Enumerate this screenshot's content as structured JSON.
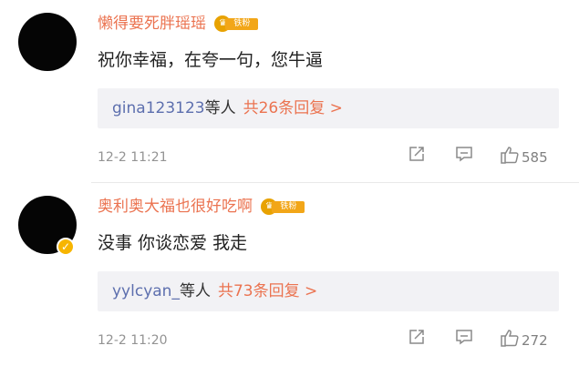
{
  "comments": [
    {
      "username": "懒得要死胖瑶瑶",
      "badge": {
        "label": "铁粉"
      },
      "text": "祝你幸福，在夸一句，您牛逼",
      "replies": {
        "user": "gina123123",
        "mid": "等人",
        "total": "共26条回复 >"
      },
      "time": "12-2 11:21",
      "likes": "585",
      "verified": false
    },
    {
      "username": "奥利奥大福也很好吃啊",
      "badge": {
        "label": "铁粉"
      },
      "text": "没事 你谈恋爱 我走",
      "replies": {
        "user": "yylcyan_",
        "mid": "等人",
        "total": "共73条回复 >"
      },
      "time": "12-2 11:20",
      "likes": "272",
      "verified": true
    }
  ],
  "icons": {
    "share": "share-icon",
    "reply": "comment-icon",
    "like": "thumbs-up-icon",
    "badge_crown": "crown-icon",
    "verified": "verified-icon"
  },
  "colors": {
    "username": "#eb7350",
    "reply_user": "#5d6fae",
    "reply_box": "#f2f2f5",
    "meta": "#939393",
    "badge": "#f2a618",
    "verified": "#f7b500"
  }
}
